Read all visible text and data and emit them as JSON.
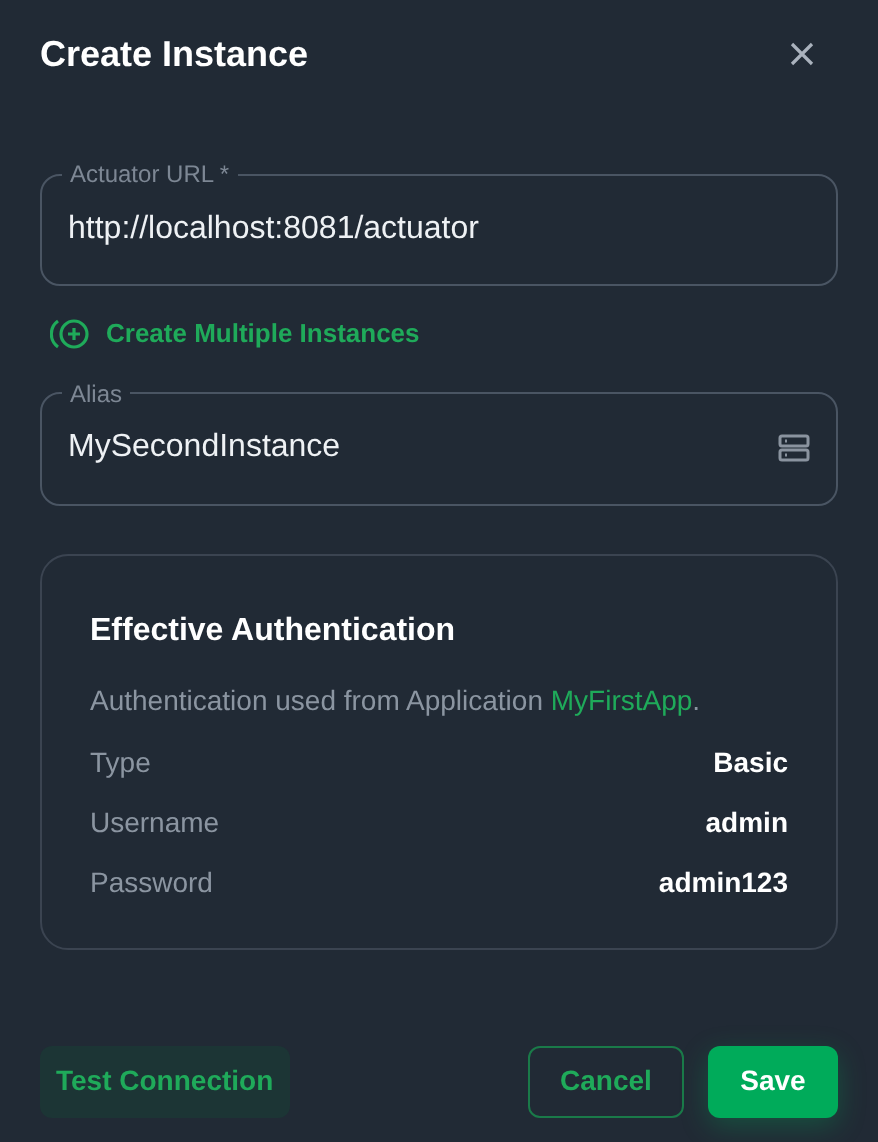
{
  "dialog": {
    "title": "Create Instance"
  },
  "url_field": {
    "label": "Actuator URL *",
    "value": "http://localhost:8081/actuator"
  },
  "multiple_link": {
    "label": "Create Multiple Instances"
  },
  "alias_field": {
    "label": "Alias",
    "value": "MySecondInstance"
  },
  "auth_card": {
    "title": "Effective Authentication",
    "text_before": "Authentication used from Application ",
    "link": "MyFirstApp",
    "text_after": ".",
    "rows": [
      {
        "label": "Type",
        "value": "Basic"
      },
      {
        "label": "Username",
        "value": "admin"
      },
      {
        "label": "Password",
        "value": "admin123"
      }
    ]
  },
  "buttons": {
    "test": "Test Connection",
    "cancel": "Cancel",
    "save": "Save"
  }
}
